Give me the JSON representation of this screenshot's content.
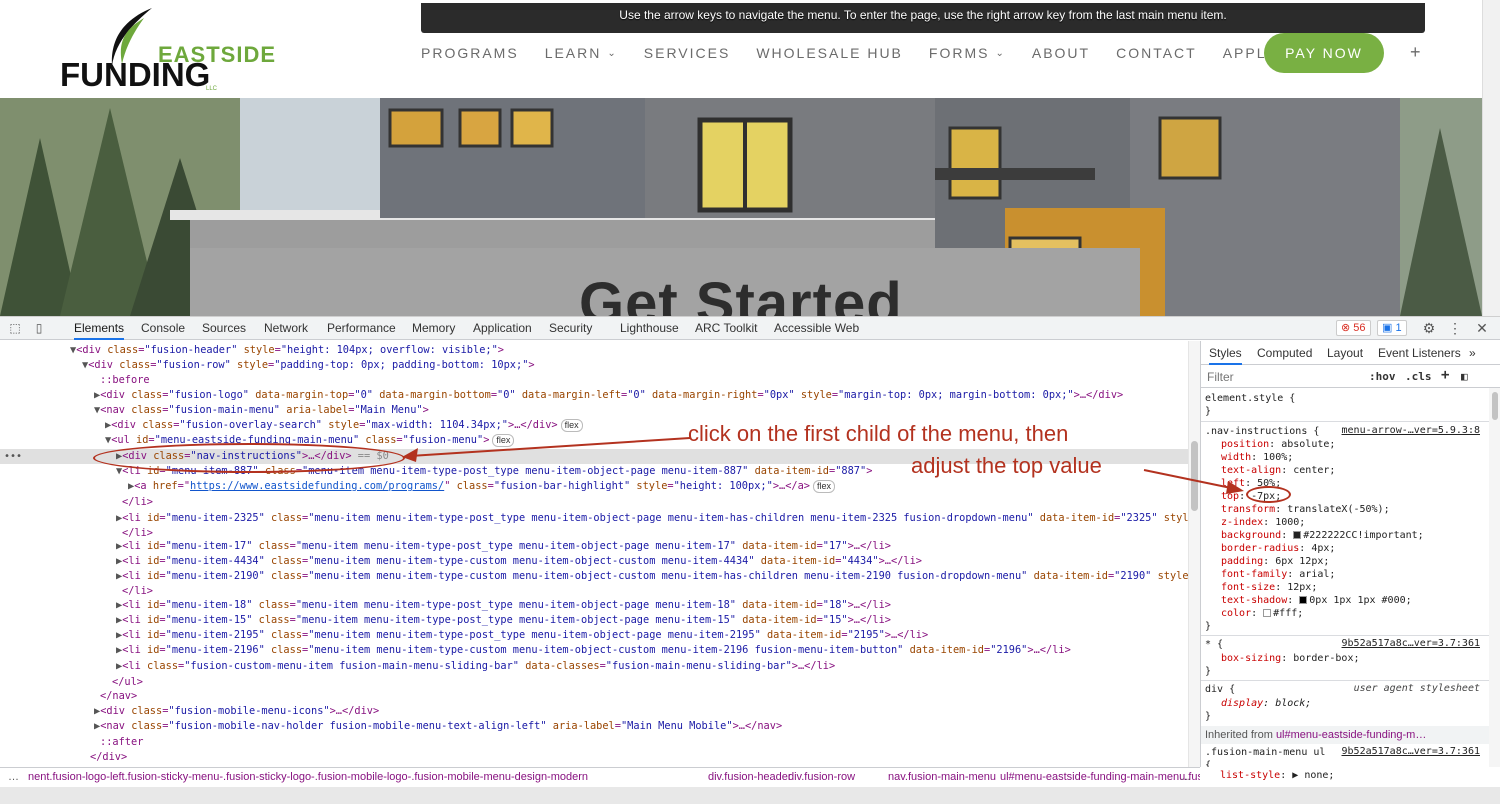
{
  "site": {
    "nav_instructions": "Use the arrow keys to navigate the menu. To enter the page, use the right arrow key from the last main menu item.",
    "logo": {
      "line1": "EASTSIDE",
      "line2": "FUNDING",
      "line3": "LLC"
    },
    "nav": [
      {
        "label": "PROGRAMS",
        "dropdown": false
      },
      {
        "label": "LEARN",
        "dropdown": true
      },
      {
        "label": "SERVICES",
        "dropdown": false
      },
      {
        "label": "WHOLESALE HUB",
        "dropdown": false
      },
      {
        "label": "FORMS",
        "dropdown": true
      },
      {
        "label": "ABOUT",
        "dropdown": false
      },
      {
        "label": "CONTACT",
        "dropdown": false
      },
      {
        "label": "APPLY NOW",
        "dropdown": false
      }
    ],
    "pay_now": "PAY NOW",
    "plus": "+",
    "hero_title": "Get Started",
    "accent_color": "#79b043"
  },
  "devtools": {
    "tabs": [
      "Elements",
      "Console",
      "Sources",
      "Network",
      "Performance",
      "Memory",
      "Application",
      "Security",
      "Lighthouse",
      "ARC Toolkit",
      "Accessible Web"
    ],
    "active_tab": "Elements",
    "errors_count": "56",
    "messages_count": "1",
    "styles_tabs": [
      "Styles",
      "Computed",
      "Layout",
      "Event Listeners"
    ],
    "filter_placeholder": "Filter",
    "hov": ":hov",
    "cls": ".cls",
    "dom": {
      "l1": {
        "t1": "<div ",
        "a1": "class",
        "v1": "\"fusion-header\"",
        "a2": "style",
        "v2": "\"height: 104px; overflow: visible;\"",
        "t2": ">"
      },
      "l2": {
        "t1": "<div ",
        "a1": "class",
        "v1": "\"fusion-row\"",
        "a2": "style",
        "v2": "\"padding-top: 0px; padding-bottom: 10px;\"",
        "t2": ">"
      },
      "l3": "::before",
      "l4": {
        "t1": "<div ",
        "a1": "class",
        "v1": "\"fusion-logo\"",
        "a2": "data-margin-top",
        "v2": "\"0\"",
        "a3": "data-margin-bottom",
        "v3": "\"0\"",
        "a4": "data-margin-left",
        "v4": "\"0\"",
        "a5": "data-margin-right",
        "v5": "\"0px\"",
        "a6": "style",
        "v6": "\"margin-top: 0px; margin-bottom: 0px;\"",
        "t2": ">…</div>"
      },
      "l5": {
        "t1": "<nav ",
        "a1": "class",
        "v1": "\"fusion-main-menu\"",
        "a2": "aria-label",
        "v2": "\"Main Menu\"",
        "t2": ">"
      },
      "l6": {
        "t1": "<div ",
        "a1": "class",
        "v1": "\"fusion-overlay-search\"",
        "a2": "style",
        "v2": "\"max-width: 1104.34px;\"",
        "t2": ">…</div>",
        "pill": "flex"
      },
      "l7": {
        "t1": "<ul ",
        "a1": "id",
        "v1": "\"menu-eastside-funding-main-menu\"",
        "a2": "class",
        "v2": "\"fusion-menu\"",
        "t2": ">",
        "pill": "flex"
      },
      "l8": {
        "t1": "<div ",
        "a1": "class",
        "v1": "\"nav-instructions\"",
        "t2": ">…</div>",
        "g": " == $0"
      },
      "l9": {
        "t1": "<li ",
        "a1": "id",
        "v1": "\"menu-item-887\"",
        "a2": "class",
        "v2": "\"menu-item menu-item-type-post_type menu-item-object-page menu-item-887\"",
        "a3": "data-item-id",
        "v3": "\"887\"",
        "t2": ">"
      },
      "l10": {
        "t1": "<a ",
        "a1": "href",
        "link": "https://www.eastsidefunding.com/programs/",
        "a2": "class",
        "v2": "\"fusion-bar-highlight\"",
        "a3": "style",
        "v3": "\"height: 100px;\"",
        "t2": ">…</a>",
        "pill": "flex"
      },
      "l11": "</li>",
      "l12": {
        "t1": "<li ",
        "a1": "id",
        "v1": "\"menu-item-2325\"",
        "a2": "class",
        "v2": "\"menu-item menu-item-type-post_type menu-item-object-page menu-item-has-children menu-item-2325 fusion-dropdown-menu\"",
        "a3": "data-item-id",
        "v3": "\"2325\"",
        "a4": "style…"
      },
      "l13": "</li>",
      "l14": {
        "t1": "<li ",
        "a1": "id",
        "v1": "\"menu-item-17\"",
        "a2": "class",
        "v2": "\"menu-item menu-item-type-post_type menu-item-object-page menu-item-17\"",
        "a3": "data-item-id",
        "v3": "\"17\"",
        "t2": ">…</li>"
      },
      "l15": {
        "t1": "<li ",
        "a1": "id",
        "v1": "\"menu-item-4434\"",
        "a2": "class",
        "v2": "\"menu-item menu-item-type-custom menu-item-object-custom menu-item-4434\"",
        "a3": "data-item-id",
        "v3": "\"4434\"",
        "t2": ">…</li>"
      },
      "l16": {
        "t1": "<li ",
        "a1": "id",
        "v1": "\"menu-item-2190\"",
        "a2": "class",
        "v2": "\"menu-item menu-item-type-custom menu-item-object-custom menu-item-has-children menu-item-2190 fusion-dropdown-menu\"",
        "a3": "data-item-id",
        "v3": "\"2190\"",
        "a4": "style…"
      },
      "l17": "</li>",
      "l18": {
        "t1": "<li ",
        "a1": "id",
        "v1": "\"menu-item-18\"",
        "a2": "class",
        "v2": "\"menu-item menu-item-type-post_type menu-item-object-page menu-item-18\"",
        "a3": "data-item-id",
        "v3": "\"18\"",
        "t2": ">…</li>"
      },
      "l19": {
        "t1": "<li ",
        "a1": "id",
        "v1": "\"menu-item-15\"",
        "a2": "class",
        "v2": "\"menu-item menu-item-type-post_type menu-item-object-page menu-item-15\"",
        "a3": "data-item-id",
        "v3": "\"15\"",
        "t2": ">…</li>"
      },
      "l20": {
        "t1": "<li ",
        "a1": "id",
        "v1": "\"menu-item-2195\"",
        "a2": "class",
        "v2": "\"menu-item menu-item-type-post_type menu-item-object-page menu-item-2195\"",
        "a3": "data-item-id",
        "v3": "\"2195\"",
        "t2": ">…</li>"
      },
      "l21": {
        "t1": "<li ",
        "a1": "id",
        "v1": "\"menu-item-2196\"",
        "a2": "class",
        "v2": "\"menu-item menu-item-type-custom menu-item-object-custom menu-item-2196 fusion-menu-item-button\"",
        "a3": "data-item-id",
        "v3": "\"2196\"",
        "t2": ">…</li>"
      },
      "l22": {
        "t1": "<li ",
        "a1": "class",
        "v1": "\"fusion-custom-menu-item fusion-main-menu-sliding-bar\"",
        "a2": "data-classes",
        "v2": "\"fusion-main-menu-sliding-bar\"",
        "t2": ">…</li>"
      },
      "l23": "</ul>",
      "l24": "</nav>",
      "l25": {
        "t1": "<div ",
        "a1": "class",
        "v1": "\"fusion-mobile-menu-icons\"",
        "t2": ">…</div>"
      },
      "l26": {
        "t1": "<nav ",
        "a1": "class",
        "v1": "\"fusion-mobile-nav-holder fusion-mobile-menu-text-align-left\"",
        "a2": "aria-label",
        "v2": "\"Main Menu Mobile\"",
        "t2": ">…</nav>"
      },
      "l27": "::after",
      "l28": "</div>"
    },
    "css": {
      "element_style": "element.style {",
      "close": "}",
      "rule1_selector": ".nav-instructions {",
      "rule1_source": "menu-arrow-…ver=5.9.3:8",
      "rule1": [
        {
          "p": "position",
          "v": "absolute;"
        },
        {
          "p": "width",
          "v": "100%;"
        },
        {
          "p": "text-align",
          "v": "center;"
        },
        {
          "p": "left",
          "v": "50%;"
        },
        {
          "p": "top",
          "v": "-7px;"
        },
        {
          "p": "transform",
          "v": "translateX(-50%);"
        },
        {
          "p": "z-index",
          "v": "1000;"
        },
        {
          "p": "background",
          "v": "#222222CC!important;"
        },
        {
          "p": "border-radius",
          "v": "4px;"
        },
        {
          "p": "padding",
          "v": "6px 12px;"
        },
        {
          "p": "font-family",
          "v": "arial;"
        },
        {
          "p": "font-size",
          "v": "12px;"
        },
        {
          "p": "text-shadow",
          "v": "0px 1px 1px #000;"
        },
        {
          "p": "color",
          "v": "#fff;"
        }
      ],
      "rule2_selector": "* {",
      "rule2_source": "9b52a517a8c…ver=3.7:361",
      "rule2_prop": "box-sizing",
      "rule2_val": "border-box;",
      "rule3_selector": "div {",
      "rule3_source": "user agent stylesheet",
      "rule3_prop": "display",
      "rule3_val": "block;",
      "inherited_label": "Inherited from",
      "inherited_from": "ul#menu-eastside-funding-m…",
      "rule4_selector": ".fusion-main-menu ul",
      "rule4_source": "9b52a517a8c…ver=3.7:361",
      "rule4_open": "{",
      "rule4_prop": "list-style",
      "rule4_val": "none;"
    },
    "breadcrumbs": [
      "…",
      "nent.fusion-logo-left.fusion-sticky-menu-.fusion-sticky-logo-.fusion-mobile-logo-.fusion-mobile-menu-design-modern",
      "div.fusion-header",
      "div.fusion-row",
      "nav.fusion-main-menu",
      "ul#menu-eastside-funding-main-menu.fusion-menu",
      "…"
    ]
  },
  "annotations": {
    "line1": "click on the first child of the menu, then",
    "line2": "adjust the top value",
    "color": "#b3321f"
  }
}
